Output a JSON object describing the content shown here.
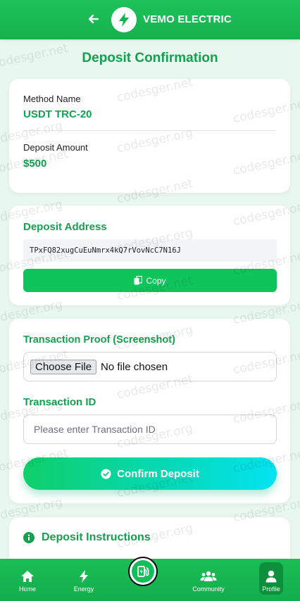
{
  "header": {
    "back_icon": "arrow-left-icon",
    "logo_icon": "bolt-icon",
    "app_title": "VEMO ELECTRIC"
  },
  "page_title": "Deposit Confirmation",
  "summary": {
    "method_label": "Method Name",
    "method_value": "USDT TRC-20",
    "amount_label": "Deposit Amount",
    "amount_value": "$500"
  },
  "address": {
    "title": "Deposit Address",
    "value": "TPxFQ82xugCuEuNmrx4kQ7rVovNcC7N16J",
    "copy_label": "Copy",
    "copy_icon": "copy-icon"
  },
  "form": {
    "proof_label": "Transaction Proof (Screenshot)",
    "choose_file_label": "Choose File",
    "no_file_text": "No file chosen",
    "txid_label": "Transaction ID",
    "txid_placeholder": "Please enter Transaction ID",
    "confirm_label": "Confirm Deposit",
    "confirm_icon": "check-circle-icon"
  },
  "instructions": {
    "title": "Deposit Instructions",
    "icon": "info-circle-icon"
  },
  "bottom_nav": {
    "items": [
      {
        "label": "Home",
        "icon": "home-icon"
      },
      {
        "label": "Energy",
        "icon": "bolt-icon"
      },
      {
        "label": "",
        "icon": "charging-station-icon"
      },
      {
        "label": "Community",
        "icon": "users-icon"
      },
      {
        "label": "Profile",
        "icon": "user-icon"
      }
    ]
  },
  "watermark": "codesger.org",
  "watermark_alt": "codesger.net",
  "colors": {
    "brand_green": "#14b14d",
    "title_green": "#12a150",
    "copy_button": "#10c45c",
    "gradient_end": "#03e3f2"
  }
}
